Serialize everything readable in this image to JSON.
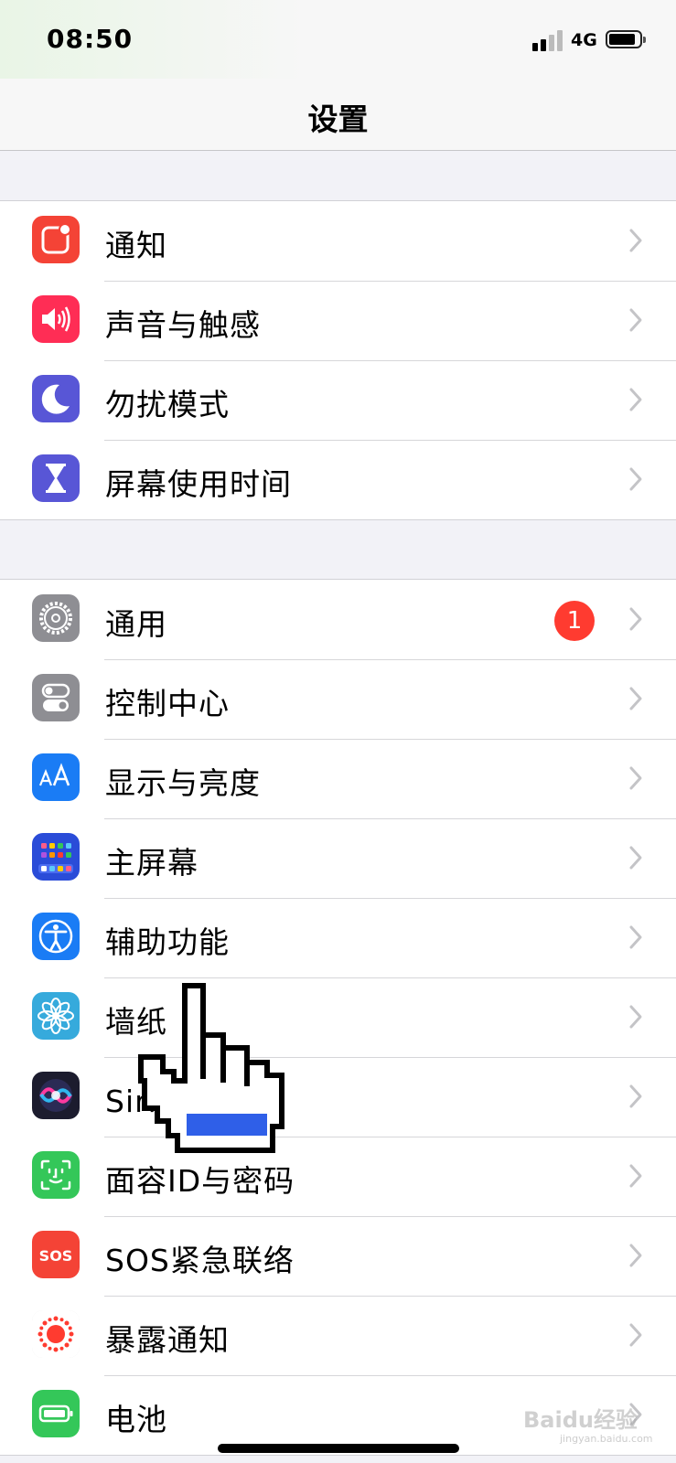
{
  "status_bar": {
    "time": "08:50",
    "network": "4G"
  },
  "nav": {
    "title": "设置"
  },
  "groups": [
    {
      "rows": [
        {
          "label": "通知",
          "icon": "notifications-icon",
          "color": "#f44336"
        },
        {
          "label": "声音与触感",
          "icon": "sounds-icon",
          "color": "#ff2d55"
        },
        {
          "label": "勿扰模式",
          "icon": "moon-icon",
          "color": "#5856d6"
        },
        {
          "label": "屏幕使用时间",
          "icon": "hourglass-icon",
          "color": "#5856d6"
        }
      ]
    },
    {
      "rows": [
        {
          "label": "通用",
          "icon": "gear-icon",
          "color": "#8e8e93",
          "badge": "1"
        },
        {
          "label": "控制中心",
          "icon": "toggles-icon",
          "color": "#8e8e93"
        },
        {
          "label": "显示与亮度",
          "icon": "text-size-icon",
          "color": "#1a7cf5"
        },
        {
          "label": "主屏幕",
          "icon": "home-screen-icon",
          "color": "#2a4cd8"
        },
        {
          "label": "辅助功能",
          "icon": "accessibility-icon",
          "color": "#1a7cf5"
        },
        {
          "label": "墙纸",
          "icon": "flower-icon",
          "color": "#36aadc"
        },
        {
          "label": "Siri与搜索",
          "icon": "siri-icon",
          "color": "#1c1c2e"
        },
        {
          "label": "面容ID与密码",
          "icon": "face-id-icon",
          "color": "#34c759"
        },
        {
          "label": "SOS紧急联络",
          "icon": "sos-icon",
          "color": "#f44336",
          "icon_text": "SOS"
        },
        {
          "label": "暴露通知",
          "icon": "exposure-icon",
          "color": "#ffffff"
        },
        {
          "label": "电池",
          "icon": "battery-icon",
          "color": "#34c759"
        }
      ]
    }
  ],
  "watermark": {
    "text": "Baidu经验",
    "sub": "jingyan.baidu.com"
  }
}
